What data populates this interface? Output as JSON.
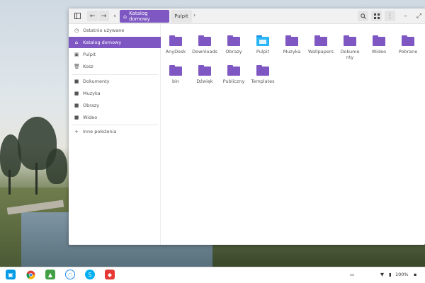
{
  "toolbar": {
    "breadcrumb_home": "Katalog domowy",
    "breadcrumb_next": "Pulpit"
  },
  "sidebar": {
    "items": [
      {
        "label": "Ostatnio używane",
        "icon": "clock-icon"
      },
      {
        "label": "Katalog domowy",
        "icon": "home-icon",
        "active": true
      },
      {
        "label": "Pulpit",
        "icon": "desktop-icon"
      },
      {
        "label": "Kosz",
        "icon": "trash-icon"
      },
      {
        "label": "Dokumenty",
        "icon": "folder-icon"
      },
      {
        "label": "Muzyka",
        "icon": "folder-icon"
      },
      {
        "label": "Obrazy",
        "icon": "folder-icon"
      },
      {
        "label": "Wideo",
        "icon": "folder-icon"
      },
      {
        "label": "Inne położenia",
        "icon": "plus-icon"
      }
    ]
  },
  "files": [
    {
      "name": "AnyDesk"
    },
    {
      "name": "Downloads"
    },
    {
      "name": "Obrazy"
    },
    {
      "name": "Pulpit",
      "special": "desktop"
    },
    {
      "name": "Muzyka"
    },
    {
      "name": "Wallpapers"
    },
    {
      "name": "Dokumenty"
    },
    {
      "name": "Wideo"
    },
    {
      "name": "Pobrane"
    },
    {
      "name": "bin"
    },
    {
      "name": "Dźwięk"
    },
    {
      "name": "Publiczny"
    },
    {
      "name": "Templates"
    }
  ],
  "tray": {
    "battery": "100%"
  },
  "colors": {
    "accent": "#7e57c2",
    "desktop_folder": "#29b6f6"
  }
}
